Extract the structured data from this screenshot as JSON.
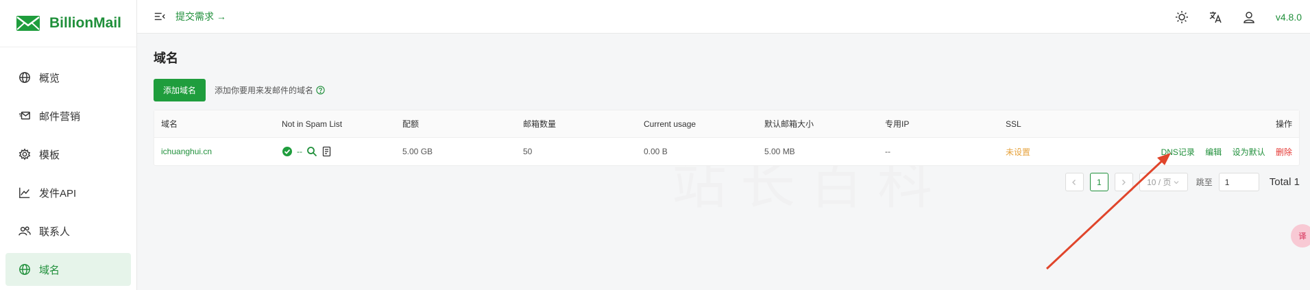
{
  "app": {
    "name": "BillionMail",
    "version": "v4.8.0",
    "brand_color": "#1f8f3a"
  },
  "header": {
    "submit_link": "提交需求 →"
  },
  "sidebar": {
    "items": [
      {
        "label": "概览",
        "icon": "globe-icon"
      },
      {
        "label": "邮件营销",
        "icon": "mail-marketing-icon"
      },
      {
        "label": "模板",
        "icon": "gear-icon"
      },
      {
        "label": "发件API",
        "icon": "chart-line-icon"
      },
      {
        "label": "联系人",
        "icon": "users-icon"
      },
      {
        "label": "域名",
        "icon": "globe-icon",
        "active": true
      }
    ]
  },
  "page": {
    "title": "域名",
    "add_button": "添加域名",
    "add_hint": "添加你要用来发邮件的域名"
  },
  "table": {
    "columns": [
      "域名",
      "Not in Spam List",
      "配额",
      "邮箱数量",
      "Current usage",
      "默认邮箱大小",
      "专用IP",
      "SSL",
      "操作"
    ],
    "rows": [
      {
        "domain": "ichuanghui.cn",
        "spam_status": "--",
        "quota": "5.00 GB",
        "mailbox_count": "50",
        "usage": "0.00 B",
        "default_size": "5.00 MB",
        "dedicated_ip": "--",
        "ssl": "未设置",
        "actions": {
          "dns": "DNS记录",
          "edit": "编辑",
          "default": "设为默认",
          "delete": "删除"
        }
      }
    ]
  },
  "pagination": {
    "current_page": "1",
    "page_size": "10 / 页",
    "jump_label": "跳至",
    "jump_value": "1",
    "total": "Total 1"
  },
  "watermark": "站长百科",
  "float_button": "译"
}
